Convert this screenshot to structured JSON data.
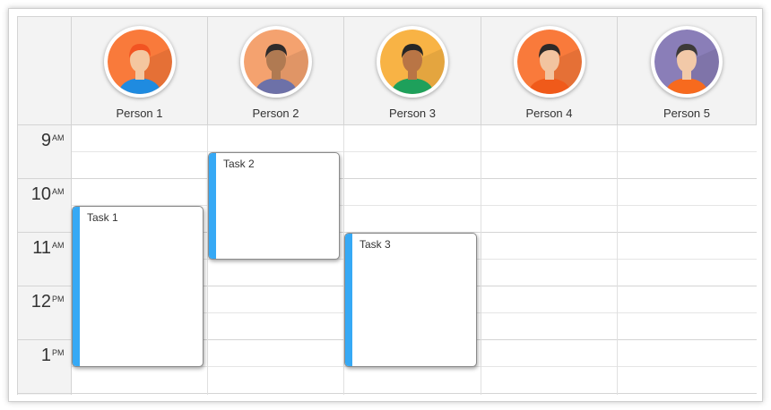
{
  "resources": [
    {
      "name": "Person 1",
      "avatar_icon": "person-1-avatar-icon",
      "bg": "#f97a3b",
      "hair": "#f25422",
      "shirt": "#1f8be0",
      "skin": "#f4c7a0"
    },
    {
      "name": "Person 2",
      "avatar_icon": "person-2-avatar-icon",
      "bg": "#f4a26f",
      "hair": "#2f2b2b",
      "shirt": "#6d71a8",
      "skin": "#b07a52"
    },
    {
      "name": "Person 3",
      "avatar_icon": "person-3-avatar-icon",
      "bg": "#f8b345",
      "hair": "#262626",
      "shirt": "#1ea05b",
      "skin": "#b97545"
    },
    {
      "name": "Person 4",
      "avatar_icon": "person-4-avatar-icon",
      "bg": "#f97a3b",
      "hair": "#2e2a28",
      "shirt": "#f05a1a",
      "skin": "#f2c4a0"
    },
    {
      "name": "Person 5",
      "avatar_icon": "person-5-avatar-icon",
      "bg": "#8a7eb8",
      "hair": "#3d3a38",
      "shirt": "#f76a1e",
      "skin": "#f2c9a8"
    }
  ],
  "time_slots": [
    {
      "hour": "9",
      "ampm": "AM"
    },
    {
      "hour": "10",
      "ampm": "AM"
    },
    {
      "hour": "11",
      "ampm": "AM"
    },
    {
      "hour": "12",
      "ampm": "PM"
    },
    {
      "hour": "1",
      "ampm": "PM"
    }
  ],
  "events": [
    {
      "text": "Task 1",
      "resource": 0,
      "start": "10:30 AM",
      "end": "1:30 PM"
    },
    {
      "text": "Task 2",
      "resource": 1,
      "start": "9:30 AM",
      "end": "11:30 AM"
    },
    {
      "text": "Task 3",
      "resource": 2,
      "start": "11:00 AM",
      "end": "1:30 PM"
    }
  ],
  "colors": {
    "event_bar": "#36a9f5",
    "header_bg": "#f3f3f3",
    "grid_line": "#d4d4d4"
  }
}
